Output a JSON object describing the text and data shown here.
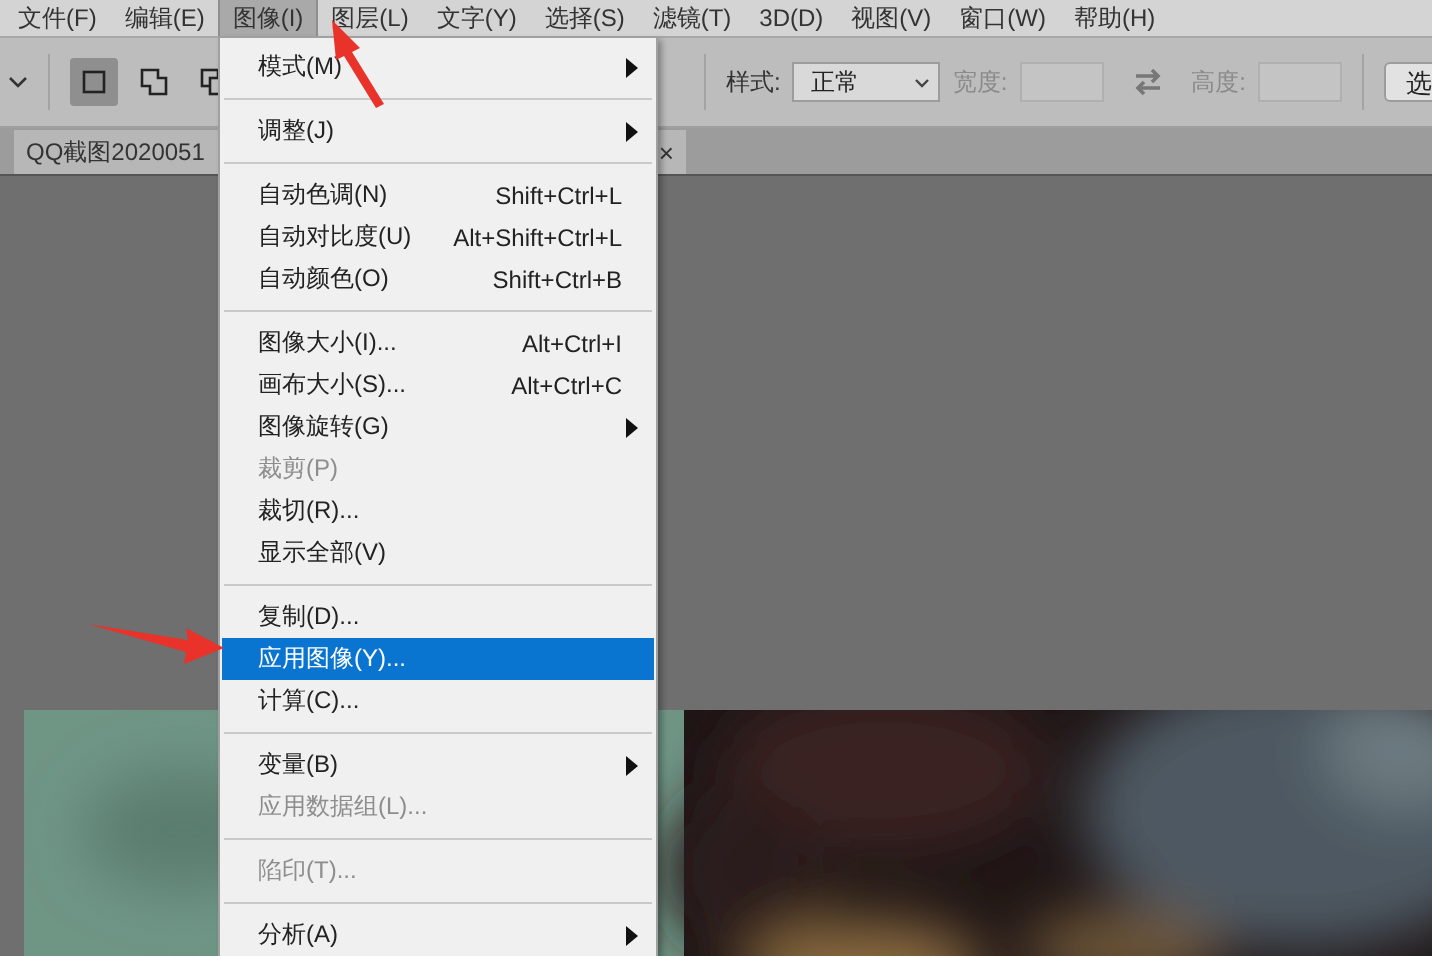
{
  "menubar": [
    {
      "label": "文件(F)",
      "selected": false
    },
    {
      "label": "编辑(E)",
      "selected": false
    },
    {
      "label": "图像(I)",
      "selected": true
    },
    {
      "label": "图层(L)",
      "selected": false
    },
    {
      "label": "文字(Y)",
      "selected": false
    },
    {
      "label": "选择(S)",
      "selected": false
    },
    {
      "label": "滤镜(T)",
      "selected": false
    },
    {
      "label": "3D(D)",
      "selected": false
    },
    {
      "label": "视图(V)",
      "selected": false
    },
    {
      "label": "窗口(W)",
      "selected": false
    },
    {
      "label": "帮助(H)",
      "selected": false
    }
  ],
  "options_bar": {
    "tools": [
      {
        "selected": true
      },
      {
        "selected": false
      },
      {
        "selected": false
      }
    ],
    "style_label": "样式:",
    "style_value": "正常",
    "width_label": "宽度:",
    "height_label": "高度:",
    "button": "选"
  },
  "document_tab": {
    "title": "QQ截图2020051",
    "close": "×"
  },
  "image_menu": [
    {
      "kind": "item",
      "label": "模式(M)",
      "submenu": true,
      "disabled": false,
      "selected": false
    },
    {
      "kind": "separator"
    },
    {
      "kind": "item",
      "label": "调整(J)",
      "submenu": true,
      "disabled": false,
      "selected": false
    },
    {
      "kind": "separator"
    },
    {
      "kind": "item",
      "label": "自动色调(N)",
      "shortcut": "Shift+Ctrl+L",
      "submenu": false,
      "disabled": false,
      "selected": false
    },
    {
      "kind": "item",
      "label": "自动对比度(U)",
      "shortcut": "Alt+Shift+Ctrl+L",
      "submenu": false,
      "disabled": false,
      "selected": false
    },
    {
      "kind": "item",
      "label": "自动颜色(O)",
      "shortcut": "Shift+Ctrl+B",
      "submenu": false,
      "disabled": false,
      "selected": false
    },
    {
      "kind": "separator"
    },
    {
      "kind": "item",
      "label": "图像大小(I)...",
      "shortcut": "Alt+Ctrl+I",
      "submenu": false,
      "disabled": false,
      "selected": false
    },
    {
      "kind": "item",
      "label": "画布大小(S)...",
      "shortcut": "Alt+Ctrl+C",
      "submenu": false,
      "disabled": false,
      "selected": false
    },
    {
      "kind": "item",
      "label": "图像旋转(G)",
      "submenu": true,
      "disabled": false,
      "selected": false
    },
    {
      "kind": "item",
      "label": "裁剪(P)",
      "submenu": false,
      "disabled": true,
      "selected": false
    },
    {
      "kind": "item",
      "label": "裁切(R)...",
      "submenu": false,
      "disabled": false,
      "selected": false
    },
    {
      "kind": "item",
      "label": "显示全部(V)",
      "submenu": false,
      "disabled": false,
      "selected": false
    },
    {
      "kind": "separator"
    },
    {
      "kind": "item",
      "label": "复制(D)...",
      "submenu": false,
      "disabled": false,
      "selected": false
    },
    {
      "kind": "item",
      "label": "应用图像(Y)...",
      "submenu": false,
      "disabled": false,
      "selected": true
    },
    {
      "kind": "item",
      "label": "计算(C)...",
      "submenu": false,
      "disabled": false,
      "selected": false
    },
    {
      "kind": "separator"
    },
    {
      "kind": "item",
      "label": "变量(B)",
      "submenu": true,
      "disabled": false,
      "selected": false
    },
    {
      "kind": "item",
      "label": "应用数据组(L)...",
      "submenu": false,
      "disabled": true,
      "selected": false
    },
    {
      "kind": "separator"
    },
    {
      "kind": "item",
      "label": "陷印(T)...",
      "submenu": false,
      "disabled": true,
      "selected": false
    },
    {
      "kind": "separator"
    },
    {
      "kind": "item",
      "label": "分析(A)",
      "submenu": true,
      "disabled": false,
      "selected": false
    }
  ]
}
